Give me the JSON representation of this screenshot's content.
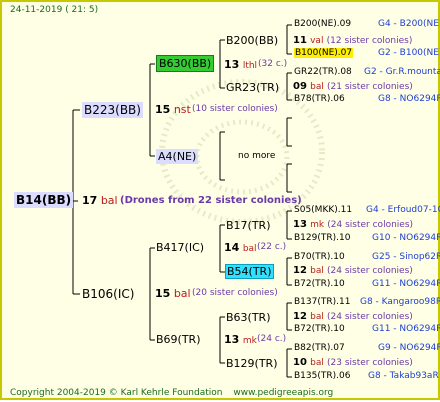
{
  "header": {
    "date": "24-11-2019",
    "time": "( 21: 5)"
  },
  "footer": {
    "copyright": "Copyright 2004-2019 © Karl Kehrle Foundation",
    "site": "www.pedigreeapis.org"
  },
  "root": {
    "name": "B14(BB)",
    "gen": "17",
    "code": "bal",
    "note": "(Drones from 22 sister colonies)"
  },
  "sire": {
    "name": "B223(BB)",
    "gen": "15",
    "code": "nst",
    "note": "(10 sister colonies)",
    "sire": {
      "name": "B630(BB)",
      "gen": "13",
      "code": "lthl",
      "note": "(32 c.)"
    },
    "dam": {
      "name": "A4(NE)",
      "no_more": "no more"
    },
    "gsire": {
      "name": "B200(BB)",
      "gen": "11",
      "code": "val",
      "note": "(12 sister colonies)"
    },
    "gdam": {
      "name": "GR23(TR)",
      "gen": "09",
      "code": "bal",
      "note": "(21 sister colonies)"
    }
  },
  "dam": {
    "name": "B106(IC)",
    "gen": "15",
    "code": "bal",
    "note": "(20 sister colonies)",
    "sire": {
      "name": "B417(IC)",
      "gen": "14",
      "code": "bal",
      "note": "(22 c.)"
    },
    "dam": {
      "name": "B69(TR)",
      "gen": "13",
      "code": "mk",
      "note": "(24 c.)"
    },
    "b17": {
      "name": "B17(TR)",
      "gen": "13",
      "code": "mk",
      "note": "(24 sister colonies)"
    },
    "b54": {
      "name": "B54(TR)",
      "gen": "12",
      "code": "bal",
      "note": "(24 sister colonies)"
    },
    "b63": {
      "name": "B63(TR)",
      "gen": "12",
      "code": "bal",
      "note": "(24 sister colonies)"
    },
    "b129": {
      "name": "B129(TR)",
      "gen": "10",
      "code": "bal",
      "note": "(23 sister colonies)"
    }
  },
  "leaves": [
    {
      "name": "B200(NE).09",
      "ref": "G4 - B200(NE)"
    },
    {
      "name": "B100(NE).07",
      "ref": "G2 - B100(NE)"
    },
    {
      "name": "GR22(TR).08",
      "ref": "G2 - Gr.R.mounta"
    },
    {
      "name": "B78(TR).06",
      "ref": "G8 - NO6294R"
    },
    {
      "name": "S05(MKK).11",
      "ref": "G4 - Erfoud07-1Q"
    },
    {
      "name": "B129(TR).10",
      "ref": "G10 - NO6294R"
    },
    {
      "name": "B70(TR).10",
      "ref": "G25 - Sinop62R"
    },
    {
      "name": "B72(TR).10",
      "ref": "G11 - NO6294R"
    },
    {
      "name": "B137(TR).11",
      "ref": "G8 - Kangaroo98R"
    },
    {
      "name": "B72(TR).10",
      "ref": "G11 - NO6294R"
    },
    {
      "name": "B82(TR).07",
      "ref": "G9 - NO6294R"
    },
    {
      "name": "B135(TR).06",
      "ref": "G8 - Takab93aR"
    }
  ]
}
